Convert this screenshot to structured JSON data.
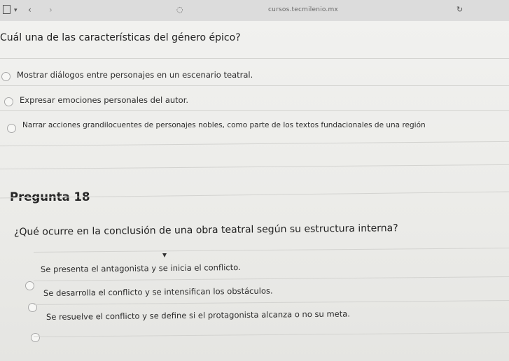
{
  "browser": {
    "url": "cursos.tecmilenio.mx",
    "icons": [
      "sidebar-toggle-icon",
      "chevron-down-icon",
      "back-arrow-icon",
      "forward-arrow-icon",
      "shield-icon",
      "reload-icon"
    ]
  },
  "question_prev": {
    "text": "Cuál una de las características del género épico?",
    "options": [
      "Mostrar diálogos entre personajes en un escenario teatral.",
      "Expresar emociones personales del autor.",
      "Narrar acciones grandilocuentes de personajes nobles, como parte de los textos fundacionales de una región"
    ]
  },
  "question_18": {
    "label": "Pregunta 18",
    "text": "¿Qué ocurre en la conclusión de una obra teatral según su estructura interna?",
    "options": [
      "Se presenta el antagonista y se inicia el conflicto.",
      "Se desarrolla el conflicto y se intensifican los obstáculos.",
      "Se resuelve el conflicto y se define si el protagonista alcanza o no su meta."
    ]
  }
}
